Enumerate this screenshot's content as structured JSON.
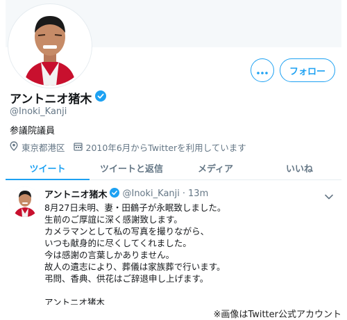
{
  "profile": {
    "name": "アントニオ猪木",
    "handle": "@Inoki_Kanji",
    "bio": "参議院議員",
    "location": "東京都港区",
    "joined": "2010年6月からTwitterを利用しています",
    "follow_label": "フォロー",
    "more_label": "•••"
  },
  "tabs": [
    {
      "label": "ツイート",
      "active": true
    },
    {
      "label": "ツイートと返信",
      "active": false
    },
    {
      "label": "メディア",
      "active": false
    },
    {
      "label": "いいね",
      "active": false
    }
  ],
  "tweet": {
    "name": "アントニオ猪木",
    "handle": "@Inoki_Kanji",
    "separator": "·",
    "time": "13m",
    "lines": [
      "8月27日未明、妻・田鶴子が永眠致しました。",
      "生前のご厚誼に深く感謝致します。",
      "カメラマンとして私の写真を撮りながら、",
      "いつも献身的に尽くしてくれました。",
      "今は感謝の言葉しかありません。",
      "故人の遺志により、葬儀は家族葬で行います。",
      "弔問、香典、供花はご辞退申し上げます。",
      "",
      "アントニオ猪木"
    ]
  },
  "caption": "※画像はTwitter公式アカウント",
  "colors": {
    "accent": "#1da1f2",
    "secondary_text": "#657786",
    "border": "#e6ecf0"
  },
  "icons": {
    "verified": "verified-badge-icon",
    "location": "location-pin-icon",
    "calendar": "calendar-icon",
    "more": "more-dots-icon",
    "chevron": "chevron-down-icon"
  }
}
